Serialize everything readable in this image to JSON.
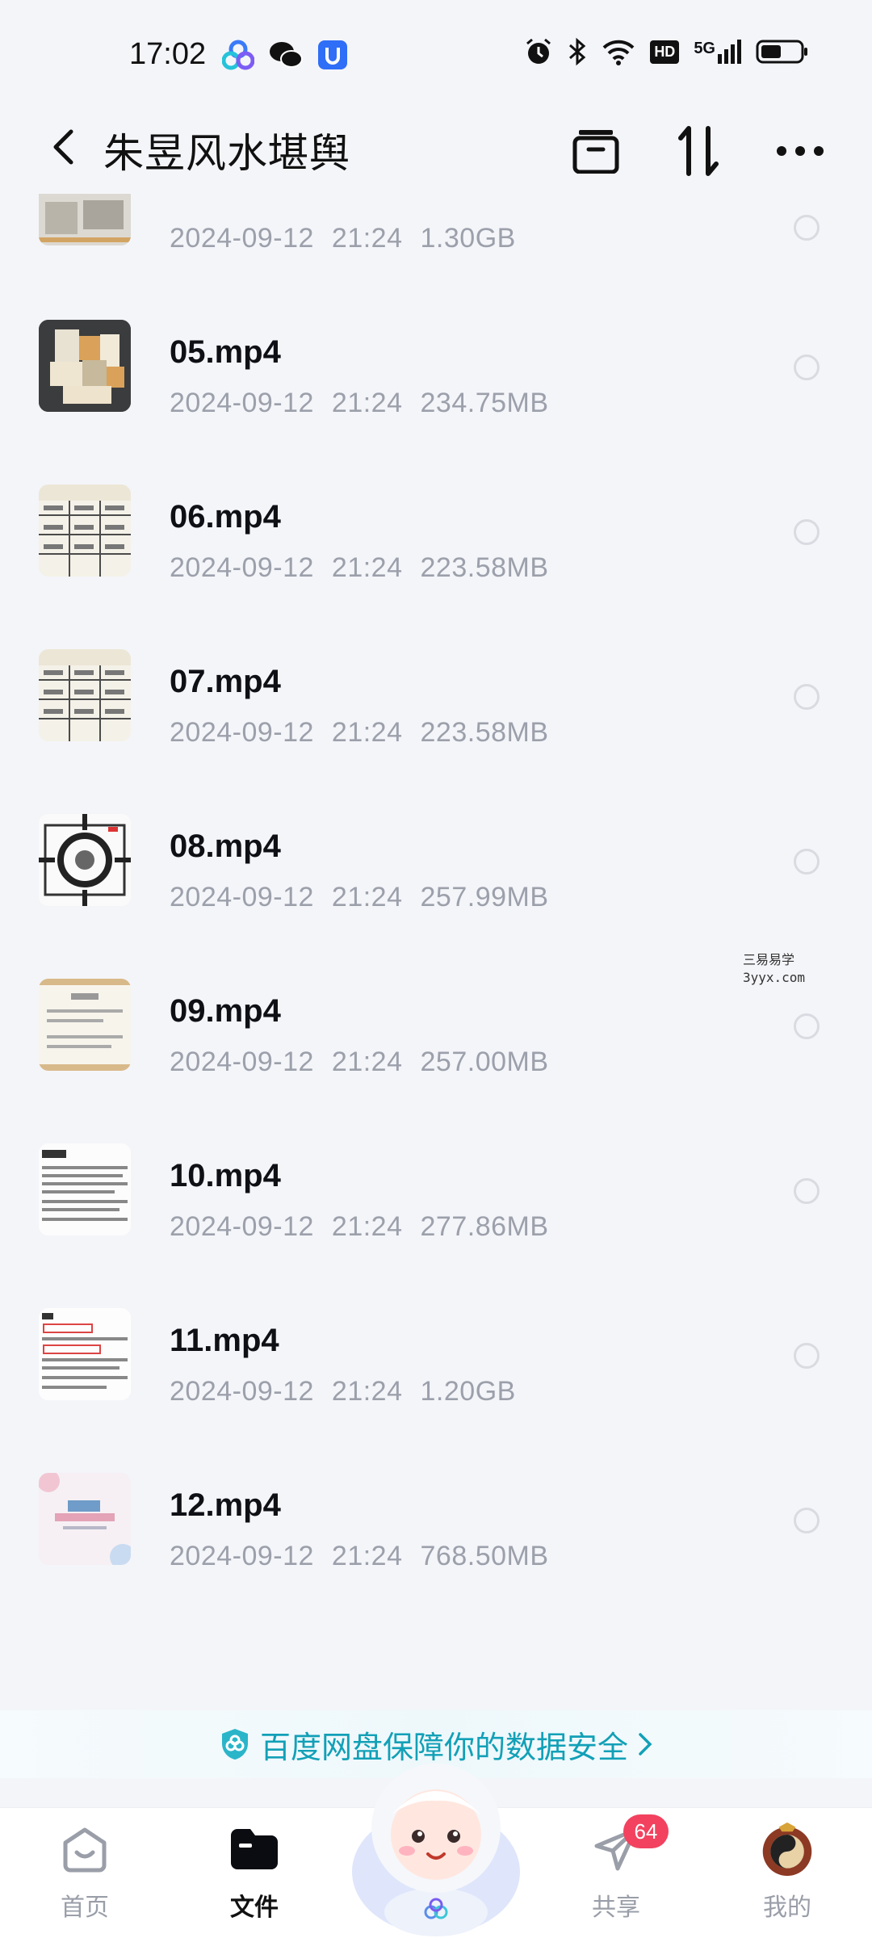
{
  "status_bar": {
    "time": "17:02",
    "network": "5G",
    "hd": "HD"
  },
  "header": {
    "title": "朱昱风水堪舆"
  },
  "files": [
    {
      "name": "",
      "date": "2024-09-12",
      "time": "21:24",
      "size": "1.30GB"
    },
    {
      "name": "05.mp4",
      "date": "2024-09-12",
      "time": "21:24",
      "size": "234.75MB"
    },
    {
      "name": "06.mp4",
      "date": "2024-09-12",
      "time": "21:24",
      "size": "223.58MB"
    },
    {
      "name": "07.mp4",
      "date": "2024-09-12",
      "time": "21:24",
      "size": "223.58MB"
    },
    {
      "name": "08.mp4",
      "date": "2024-09-12",
      "time": "21:24",
      "size": "257.99MB"
    },
    {
      "name": "09.mp4",
      "date": "2024-09-12",
      "time": "21:24",
      "size": "257.00MB"
    },
    {
      "name": "10.mp4",
      "date": "2024-09-12",
      "time": "21:24",
      "size": "277.86MB"
    },
    {
      "name": "11.mp4",
      "date": "2024-09-12",
      "time": "21:24",
      "size": "1.20GB"
    },
    {
      "name": "12.mp4",
      "date": "2024-09-12",
      "time": "21:24",
      "size": "768.50MB"
    }
  ],
  "watermark": {
    "line1": "三易易学",
    "line2": "3yyx.com"
  },
  "banner": {
    "text": "百度网盘保障你的数据安全"
  },
  "bottom_nav": {
    "home": "首页",
    "files": "文件",
    "share": "共享",
    "share_badge": "64",
    "mine": "我的"
  },
  "colors": {
    "accent": "#12a0b7",
    "badge": "#f2425f",
    "meta_text": "#9ca0ab"
  }
}
